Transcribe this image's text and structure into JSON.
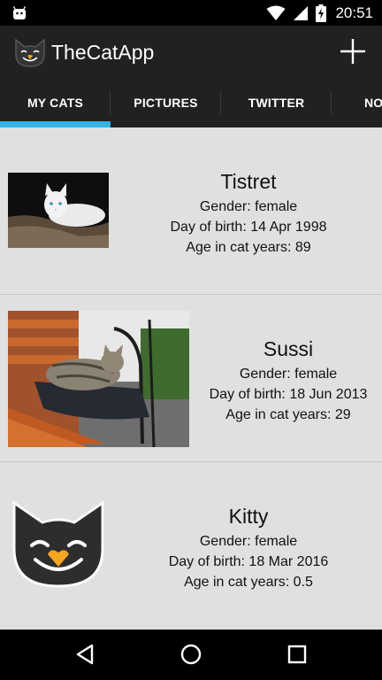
{
  "status_bar": {
    "time": "20:51",
    "icons": [
      "android-icon",
      "wifi-icon",
      "signal-icon",
      "battery-charging-icon"
    ]
  },
  "app_bar": {
    "title": "TheCatApp",
    "logo_icon": "cat-face-icon",
    "action_icon": "add-icon"
  },
  "tabs": [
    {
      "label": "MY CATS",
      "selected": true
    },
    {
      "label": "PICTURES",
      "selected": false
    },
    {
      "label": "TWITTER",
      "selected": false
    },
    {
      "label": "NO",
      "selected": false
    }
  ],
  "colors": {
    "tab_indicator": "#33b5e5",
    "app_bar": "#212121",
    "list_bg": "#e0e0e0"
  },
  "cats": [
    {
      "name": "Tistret",
      "gender": "Gender: female",
      "birth": "Day of birth: 14 Apr 1998",
      "age": "Age in cat years: 89",
      "image": "white-cat-photo"
    },
    {
      "name": "Sussi",
      "gender": "Gender: female",
      "birth": "Day of birth: 18 Jun 2013",
      "age": "Age in cat years: 29",
      "image": "tabby-cat-on-bench-photo"
    },
    {
      "name": "Kitty",
      "gender": "Gender: female",
      "birth": "Day of birth: 18 Mar 2016",
      "age": "Age in cat years: 0.5",
      "image": "cat-face-icon"
    }
  ],
  "nav_bar": {
    "icons": [
      "back-icon",
      "home-icon",
      "recents-icon"
    ]
  }
}
